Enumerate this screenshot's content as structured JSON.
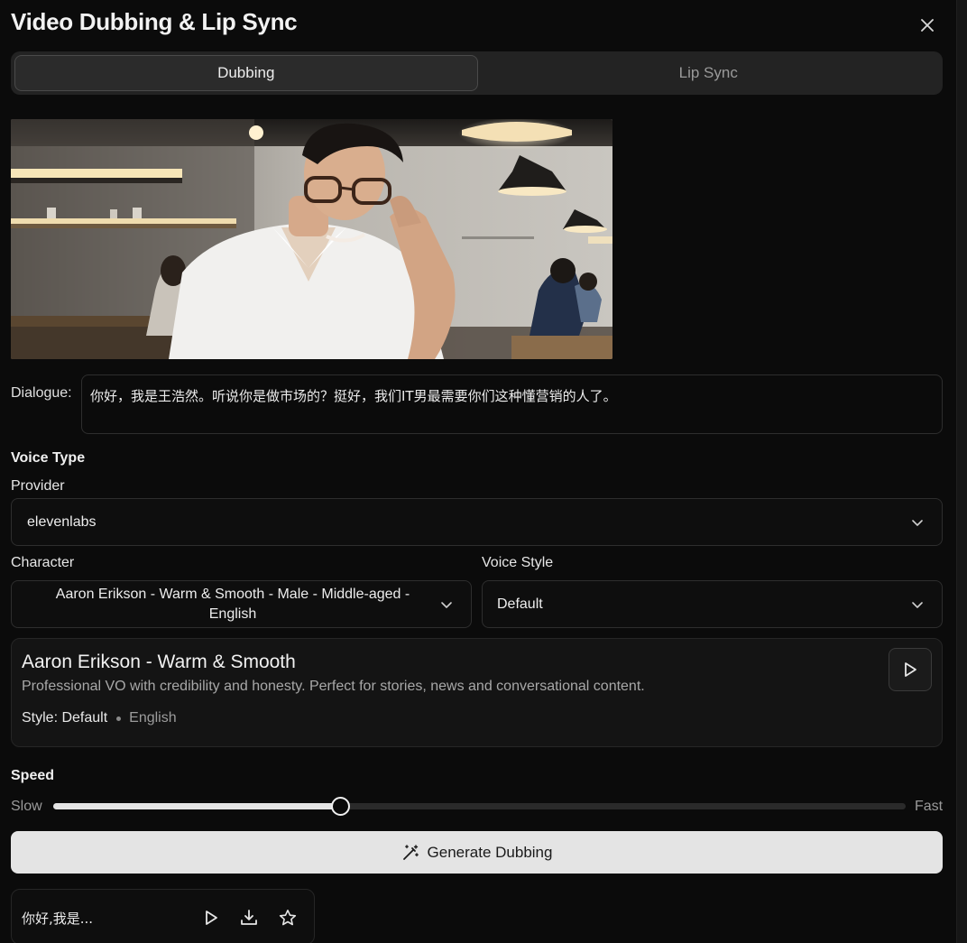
{
  "window": {
    "title": "Video Dubbing & Lip Sync"
  },
  "tabs": [
    {
      "label": "Dubbing",
      "active": true
    },
    {
      "label": "Lip Sync",
      "active": false
    }
  ],
  "dialogue": {
    "label": "Dialogue:",
    "value": "你好，我是王浩然。听说你是做市场的？挺好，我们IT男最需要你们这种懂营销的人了。"
  },
  "voice_type": {
    "title": "Voice Type",
    "provider": {
      "label": "Provider",
      "value": "elevenlabs"
    },
    "character": {
      "label": "Character",
      "value_line1": "Aaron Erikson - Warm & Smooth - Male - Middle-aged -",
      "value_line2": "English"
    },
    "voice_style": {
      "label": "Voice Style",
      "value": "Default"
    }
  },
  "voice_card": {
    "name": "Aaron Erikson - Warm & Smooth",
    "description": "Professional VO with credibility and honesty. Perfect for stories, news and conversational content.",
    "style": "Style: Default",
    "language": "English"
  },
  "speed": {
    "title": "Speed",
    "min_label": "Slow",
    "max_label": "Fast",
    "value": 0.337
  },
  "generate_button": {
    "label": "Generate Dubbing",
    "icon": "magic-wand-icon"
  },
  "result": {
    "text": "你好,我是..."
  },
  "colors": {
    "background": "#0b0b0b",
    "accent_button": "#e4e4e4",
    "border": "#2e2e2e"
  }
}
